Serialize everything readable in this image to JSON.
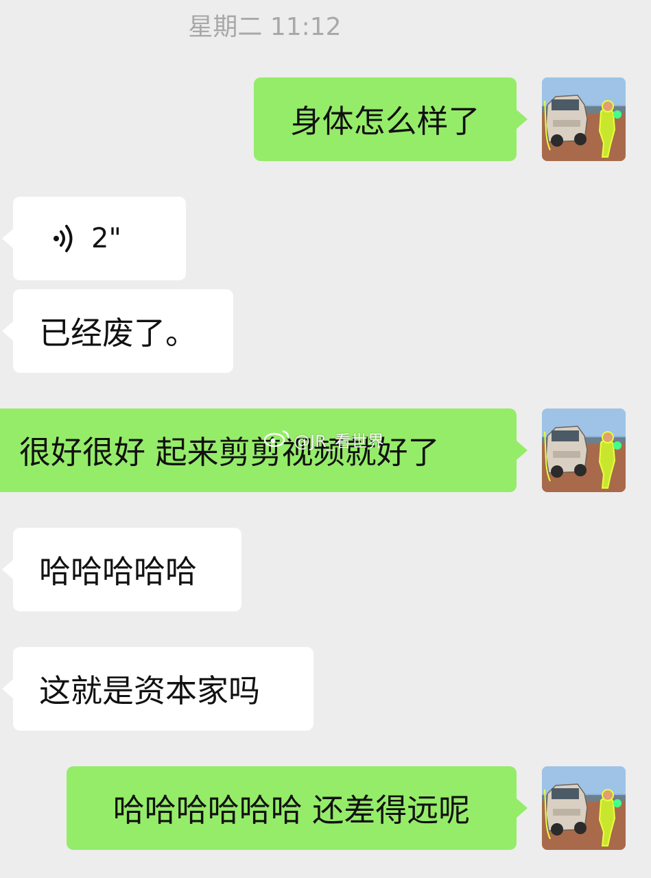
{
  "timestamp": "星期二 11:12",
  "messages": [
    {
      "dir": "out",
      "text": "身体怎么样了"
    },
    {
      "dir": "in",
      "type": "voice",
      "duration": "2\""
    },
    {
      "dir": "in",
      "text": "已经废了。"
    },
    {
      "dir": "out",
      "text": "很好很好 起来剪剪视频就好了"
    },
    {
      "dir": "in",
      "text": "哈哈哈哈哈"
    },
    {
      "dir": "in",
      "text": "这就是资本家吗"
    },
    {
      "dir": "out",
      "text": "哈哈哈哈哈哈 还差得远呢"
    }
  ],
  "watermark": "@JR_看世界",
  "icons": {
    "voice": "voice-wave-icon",
    "avatar": "user-avatar-photo",
    "watermark": "weibo-logo-icon"
  },
  "colors": {
    "background": "#ededed",
    "outgoing_bubble": "#95ec69",
    "incoming_bubble": "#ffffff",
    "timestamp_text": "#a8a8a8"
  }
}
